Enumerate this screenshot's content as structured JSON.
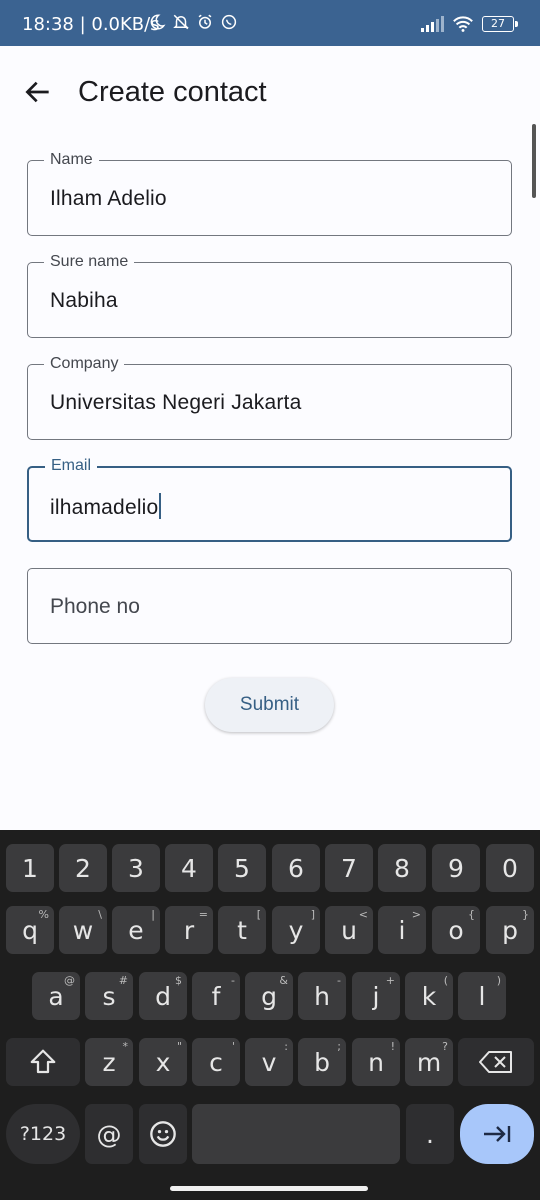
{
  "status": {
    "text": "18:38 | 0.0KB/s",
    "battery": "27"
  },
  "header": {
    "title": "Create contact"
  },
  "form": {
    "name": {
      "label": "Name",
      "value": "Ilham Adelio"
    },
    "surename": {
      "label": "Sure name",
      "value": "Nabiha"
    },
    "company": {
      "label": "Company",
      "value": "Universitas Negeri Jakarta"
    },
    "email": {
      "label": "Email",
      "value": "ilhamadelio"
    },
    "phone": {
      "placeholder": "Phone no"
    },
    "submit_label": "Submit"
  },
  "keyboard": {
    "numbers": [
      "1",
      "2",
      "3",
      "4",
      "5",
      "6",
      "7",
      "8",
      "9",
      "0"
    ],
    "row1": [
      "q",
      "w",
      "e",
      "r",
      "t",
      "y",
      "u",
      "i",
      "o",
      "p"
    ],
    "row1_hints": [
      "%",
      "\\",
      "|",
      "=",
      "[",
      "]",
      "<",
      ">",
      "{",
      "}"
    ],
    "row2": [
      "a",
      "s",
      "d",
      "f",
      "g",
      "h",
      "j",
      "k",
      "l"
    ],
    "row2_hints": [
      "@",
      "#",
      "$",
      "-",
      "&",
      "-",
      "+",
      "(",
      ")"
    ],
    "row3": [
      "z",
      "x",
      "c",
      "v",
      "b",
      "n",
      "m"
    ],
    "row3_hints": [
      "*",
      "\"",
      "'",
      ":",
      ";",
      "!",
      "?"
    ],
    "sym_label": "?123",
    "at_label": "@",
    "period_label": "."
  }
}
